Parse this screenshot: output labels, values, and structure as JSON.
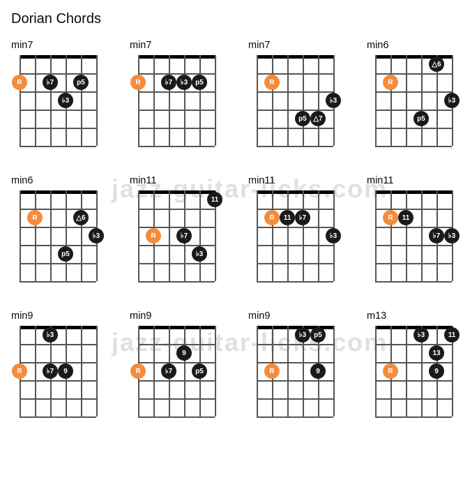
{
  "title": "Dorian Chords",
  "watermark": "jazz-guitar-licks.com",
  "diagram": {
    "strings": 6,
    "frets": 5,
    "stringGap": 22,
    "fretGap": 26,
    "dotSize": 22,
    "colors": {
      "root": "#f58b3c",
      "other": "#1a1a1a"
    }
  },
  "chords": [
    {
      "label": "min7",
      "dots": [
        {
          "string": 0,
          "fret": 2,
          "text": "R",
          "root": true
        },
        {
          "string": 2,
          "fret": 2,
          "text": "♭7"
        },
        {
          "string": 4,
          "fret": 2,
          "text": "p5"
        },
        {
          "string": 3,
          "fret": 3,
          "text": "♭3"
        }
      ]
    },
    {
      "label": "min7",
      "dots": [
        {
          "string": 0,
          "fret": 2,
          "text": "R",
          "root": true
        },
        {
          "string": 2,
          "fret": 2,
          "text": "♭7"
        },
        {
          "string": 3,
          "fret": 2,
          "text": "♭3"
        },
        {
          "string": 4,
          "fret": 2,
          "text": "p5"
        }
      ]
    },
    {
      "label": "min7",
      "dots": [
        {
          "string": 1,
          "fret": 2,
          "text": "R",
          "root": true
        },
        {
          "string": 5,
          "fret": 3,
          "text": "♭3"
        },
        {
          "string": 3,
          "fret": 4,
          "text": "p5"
        },
        {
          "string": 4,
          "fret": 4,
          "text": "△7"
        }
      ]
    },
    {
      "label": "min6",
      "dots": [
        {
          "string": 4,
          "fret": 1,
          "text": "△6"
        },
        {
          "string": 1,
          "fret": 2,
          "text": "R",
          "root": true
        },
        {
          "string": 5,
          "fret": 3,
          "text": "♭3"
        },
        {
          "string": 3,
          "fret": 4,
          "text": "p5"
        }
      ]
    },
    {
      "label": "min6",
      "dots": [
        {
          "string": 1,
          "fret": 2,
          "text": "R",
          "root": true
        },
        {
          "string": 4,
          "fret": 2,
          "text": "△6"
        },
        {
          "string": 5,
          "fret": 3,
          "text": "♭3"
        },
        {
          "string": 3,
          "fret": 4,
          "text": "p5"
        }
      ]
    },
    {
      "label": "min11",
      "dots": [
        {
          "string": 5,
          "fret": 1,
          "text": "11"
        },
        {
          "string": 1,
          "fret": 3,
          "text": "R",
          "root": true
        },
        {
          "string": 3,
          "fret": 3,
          "text": "♭7"
        },
        {
          "string": 4,
          "fret": 4,
          "text": "♭3"
        }
      ]
    },
    {
      "label": "min11",
      "dots": [
        {
          "string": 1,
          "fret": 2,
          "text": "R",
          "root": true
        },
        {
          "string": 2,
          "fret": 2,
          "text": "11"
        },
        {
          "string": 3,
          "fret": 2,
          "text": "♭7"
        },
        {
          "string": 5,
          "fret": 3,
          "text": "♭3"
        }
      ]
    },
    {
      "label": "min11",
      "dots": [
        {
          "string": 1,
          "fret": 2,
          "text": "R",
          "root": true
        },
        {
          "string": 2,
          "fret": 2,
          "text": "11"
        },
        {
          "string": 4,
          "fret": 3,
          "text": "♭7"
        },
        {
          "string": 5,
          "fret": 3,
          "text": "♭3"
        }
      ]
    },
    {
      "label": "min9",
      "dots": [
        {
          "string": 2,
          "fret": 1,
          "text": "♭3"
        },
        {
          "string": 0,
          "fret": 3,
          "text": "R",
          "root": true
        },
        {
          "string": 2,
          "fret": 3,
          "text": "♭7"
        },
        {
          "string": 3,
          "fret": 3,
          "text": "9"
        }
      ]
    },
    {
      "label": "min9",
      "dots": [
        {
          "string": 3,
          "fret": 2,
          "text": "9"
        },
        {
          "string": 0,
          "fret": 3,
          "text": "R",
          "root": true
        },
        {
          "string": 2,
          "fret": 3,
          "text": "♭7"
        },
        {
          "string": 4,
          "fret": 3,
          "text": "p5"
        }
      ]
    },
    {
      "label": "min9",
      "dots": [
        {
          "string": 3,
          "fret": 1,
          "text": "♭3"
        },
        {
          "string": 4,
          "fret": 1,
          "text": "p5"
        },
        {
          "string": 1,
          "fret": 3,
          "text": "R",
          "root": true
        },
        {
          "string": 4,
          "fret": 3,
          "text": "9"
        }
      ]
    },
    {
      "label": "m13",
      "dots": [
        {
          "string": 3,
          "fret": 1,
          "text": "♭3"
        },
        {
          "string": 5,
          "fret": 1,
          "text": "11"
        },
        {
          "string": 4,
          "fret": 2,
          "text": "13"
        },
        {
          "string": 1,
          "fret": 3,
          "text": "R",
          "root": true
        },
        {
          "string": 4,
          "fret": 3,
          "text": "9"
        }
      ]
    }
  ]
}
